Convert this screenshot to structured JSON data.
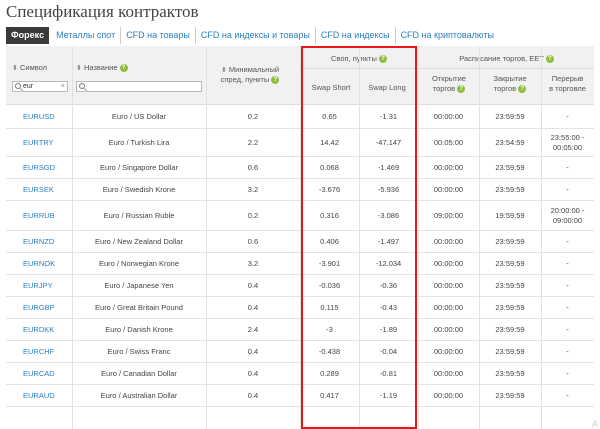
{
  "page": {
    "title": "Спецификация контрактов"
  },
  "tabs": [
    {
      "label": "Форекс",
      "active": true
    },
    {
      "label": "Металлы спот",
      "active": false
    },
    {
      "label": "CFD на товары",
      "active": false
    },
    {
      "label": "CFD на индексы и товары",
      "active": false
    },
    {
      "label": "CFD на индексы",
      "active": false
    },
    {
      "label": "CFD на криптовалюты",
      "active": false
    }
  ],
  "columns": {
    "symbol": "Символ",
    "name": "Название",
    "spread_line1": "Минимальный",
    "spread_line2": "спред, пункты",
    "swap_group": "Своп, пункты",
    "swap_short": "Swap Short",
    "swap_long": "Swap Long",
    "schedule_group": "Расписание торгов, EET",
    "open_line1": "Открытие",
    "open_line2": "торгов",
    "close_line1": "Закрытие",
    "close_line2": "торгов",
    "break_line1": "Перерыв",
    "break_line2": "в торговле"
  },
  "filters": {
    "symbol_value": "eur",
    "symbol_clear": "×",
    "name_value": ""
  },
  "icons": {
    "sort": "sort-arrows-icon",
    "help": "question-circle-icon",
    "search": "search-icon",
    "help_glyph": "?",
    "sort_glyph": "⬍"
  },
  "colors": {
    "link": "#2a7fc1",
    "help_badge": "#8fbf3a",
    "highlight_border": "#e01a1a",
    "active_tab": "#3a3a3a"
  },
  "rows": [
    {
      "symbol": "EURUSD",
      "name": "Euro / US Dollar",
      "spread": "0.2",
      "swap_short": "0.65",
      "swap_long": "-1.31",
      "open": "00:00:00",
      "close": "23:59:59",
      "break": "-"
    },
    {
      "symbol": "EURTRY",
      "name": "Euro / Turkish Lira",
      "spread": "2.2",
      "swap_short": "14.42",
      "swap_long": "-47.147",
      "open": "00:05:00",
      "close": "23:54:59",
      "break": "23:55:00 - 00:05:00"
    },
    {
      "symbol": "EURSGD",
      "name": "Euro / Singapore Dollar",
      "spread": "0.6",
      "swap_short": "0.068",
      "swap_long": "-1.469",
      "open": "00:00:00",
      "close": "23:59:59",
      "break": "-"
    },
    {
      "symbol": "EURSEK",
      "name": "Euro / Swedish Krone",
      "spread": "3.2",
      "swap_short": "-3.676",
      "swap_long": "-5.936",
      "open": "00:00:00",
      "close": "23:59:59",
      "break": "-"
    },
    {
      "symbol": "EURRUB",
      "name": "Euro / Russian Ruble",
      "spread": "0.2",
      "swap_short": "0.316",
      "swap_long": "-3.086",
      "open": "09:00:00",
      "close": "19:59:59",
      "break": "20:00:00 - 09:00:00"
    },
    {
      "symbol": "EURNZD",
      "name": "Euro / New Zealand Dollar",
      "spread": "0.6",
      "swap_short": "0.406",
      "swap_long": "-1.497",
      "open": "00:00:00",
      "close": "23:59:59",
      "break": "-"
    },
    {
      "symbol": "EURNOK",
      "name": "Euro / Norwegian Krone",
      "spread": "3.2",
      "swap_short": "-3.901",
      "swap_long": "-12.034",
      "open": "00:00:00",
      "close": "23:59:59",
      "break": "-"
    },
    {
      "symbol": "EURJPY",
      "name": "Euro / Japanese Yen",
      "spread": "0.4",
      "swap_short": "-0.036",
      "swap_long": "-0.36",
      "open": "00:00:00",
      "close": "23:59:59",
      "break": "-"
    },
    {
      "symbol": "EURGBP",
      "name": "Euro / Great Britain Pound",
      "spread": "0.4",
      "swap_short": "0.115",
      "swap_long": "-0.43",
      "open": "00:00:00",
      "close": "23:59:59",
      "break": "-"
    },
    {
      "symbol": "EURDKK",
      "name": "Euro / Danish Krone",
      "spread": "2.4",
      "swap_short": "-3",
      "swap_long": "-1.89",
      "open": "00:00:00",
      "close": "23:59:59",
      "break": "-"
    },
    {
      "symbol": "EURCHF",
      "name": "Euro / Swiss Franc",
      "spread": "0.4",
      "swap_short": "-0.438",
      "swap_long": "-0.04",
      "open": "00:00:00",
      "close": "23:59:59",
      "break": "-"
    },
    {
      "symbol": "EURCAD",
      "name": "Euro / Canadian Dollar",
      "spread": "0.4",
      "swap_short": "0.289",
      "swap_long": "-0.81",
      "open": "00:00:00",
      "close": "23:59:59",
      "break": "-"
    },
    {
      "symbol": "EURAUD",
      "name": "Euro / Australian Dollar",
      "spread": "0.4",
      "swap_short": "0.417",
      "swap_long": "-1.19",
      "open": "00:00:00",
      "close": "23:59:59",
      "break": "-"
    }
  ],
  "watermark": "A"
}
